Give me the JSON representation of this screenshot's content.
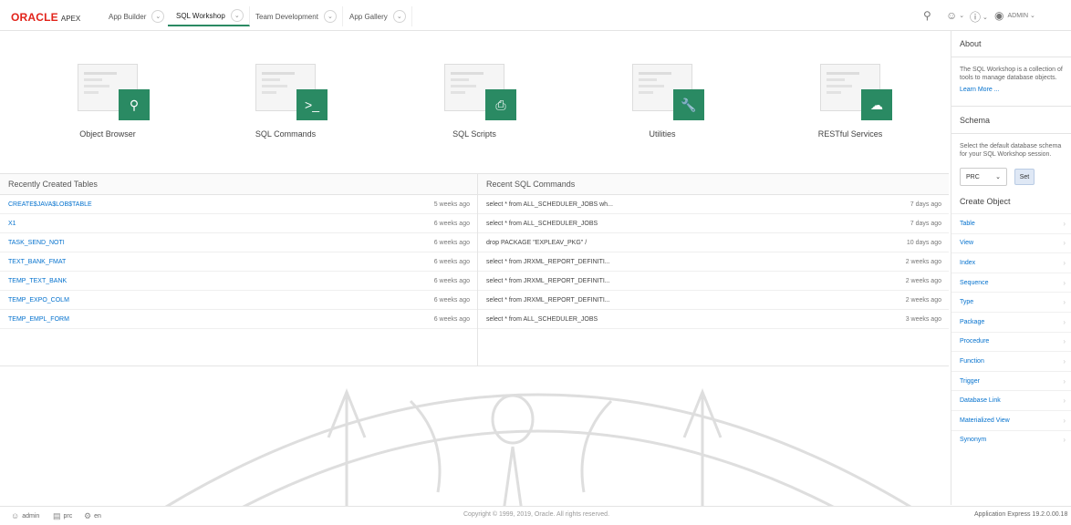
{
  "header": {
    "logo_brand": "ORACLE",
    "logo_product": "APEX",
    "tabs": [
      {
        "label": "App Builder"
      },
      {
        "label": "SQL Workshop"
      },
      {
        "label": "Team Development"
      },
      {
        "label": "App Gallery"
      }
    ],
    "user_label": "ADMIN"
  },
  "workshop_cards": [
    {
      "label": "Object Browser",
      "icon": "search-icon"
    },
    {
      "label": "SQL Commands",
      "icon": "terminal-icon"
    },
    {
      "label": "SQL Scripts",
      "icon": "script-icon"
    },
    {
      "label": "Utilities",
      "icon": "wrench-icon"
    },
    {
      "label": "RESTful Services",
      "icon": "cloud-upload-icon"
    }
  ],
  "recent_tables": {
    "title": "Recently Created Tables",
    "rows": [
      {
        "name": "CREATE$JAVA$LOB$TABLE",
        "age": "5 weeks ago"
      },
      {
        "name": "X1",
        "age": "6 weeks ago"
      },
      {
        "name": "TASK_SEND_NOTI",
        "age": "6 weeks ago"
      },
      {
        "name": "TEXT_BANK_FMAT",
        "age": "6 weeks ago"
      },
      {
        "name": "TEMP_TEXT_BANK",
        "age": "6 weeks ago"
      },
      {
        "name": "TEMP_EXPO_COLM",
        "age": "6 weeks ago"
      },
      {
        "name": "TEMP_EMPL_FORM",
        "age": "6 weeks ago"
      }
    ]
  },
  "recent_commands": {
    "title": "Recent SQL Commands",
    "rows": [
      {
        "sql": "select * from ALL_SCHEDULER_JOBS wh...",
        "age": "7 days ago"
      },
      {
        "sql": "select * from ALL_SCHEDULER_JOBS",
        "age": "7 days ago"
      },
      {
        "sql": "drop PACKAGE \"EXPLEAV_PKG\" /",
        "age": "10 days ago"
      },
      {
        "sql": "select * from JRXML_REPORT_DEFINITI...",
        "age": "2 weeks ago"
      },
      {
        "sql": "select * from JRXML_REPORT_DEFINITI...",
        "age": "2 weeks ago"
      },
      {
        "sql": "select * from JRXML_REPORT_DEFINITI...",
        "age": "2 weeks ago"
      },
      {
        "sql": "select * from ALL_SCHEDULER_JOBS",
        "age": "3 weeks ago"
      }
    ]
  },
  "sidebar": {
    "about_title": "About",
    "about_text": "The SQL Workshop is a collection of tools to manage database objects.",
    "learn_more": "Learn More ...",
    "schema_title": "Schema",
    "schema_text": "Select the default database schema for your SQL Workshop session.",
    "schema_value": "PRC",
    "set_label": "Set",
    "create_title": "Create Object",
    "create_items": [
      {
        "label": "Table"
      },
      {
        "label": "View"
      },
      {
        "label": "Index"
      },
      {
        "label": "Sequence"
      },
      {
        "label": "Type"
      },
      {
        "label": "Package"
      },
      {
        "label": "Procedure"
      },
      {
        "label": "Function"
      },
      {
        "label": "Trigger"
      },
      {
        "label": "Database Link"
      },
      {
        "label": "Materialized View"
      },
      {
        "label": "Synonym"
      }
    ]
  },
  "footer": {
    "user": "admin",
    "schema": "prc",
    "language": "en",
    "copyright": "Copyright © 1999, 2019, Oracle. All rights reserved.",
    "version": "Application Express 19.2.0.00.18"
  },
  "colors": {
    "accent": "#2a8a63",
    "brand_red": "#e2231a",
    "link": "#0572ce"
  }
}
